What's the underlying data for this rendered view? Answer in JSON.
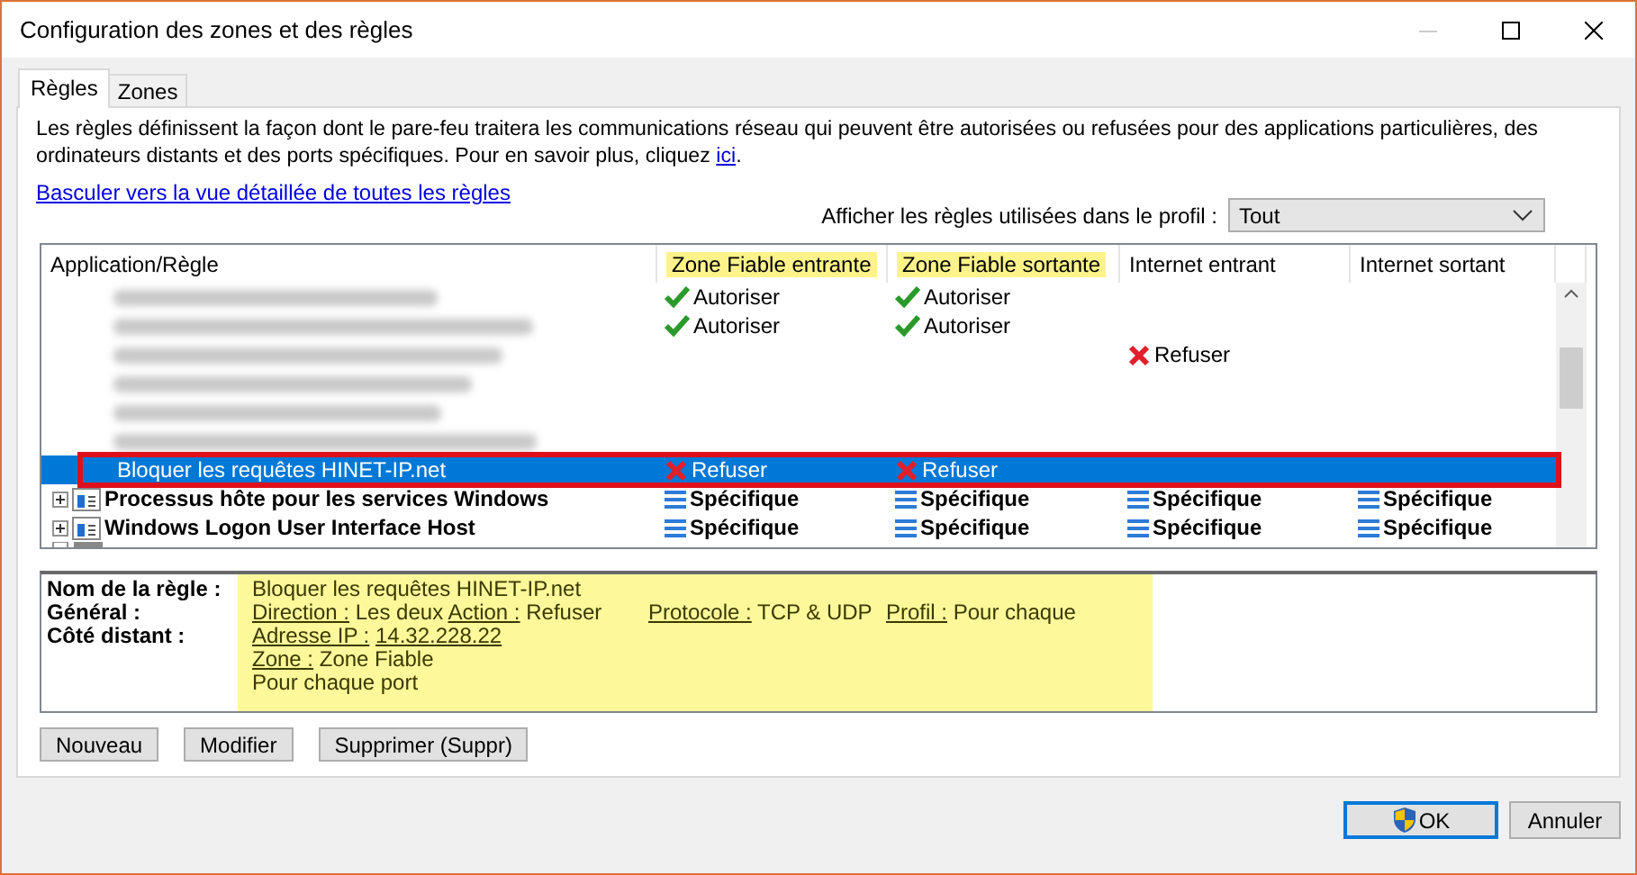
{
  "window": {
    "title": "Configuration des zones et des règles"
  },
  "tabs": [
    {
      "label": "Règles",
      "selected": true
    },
    {
      "label": "Zones",
      "selected": false
    }
  ],
  "description": {
    "text_before": "Les règles définissent la façon dont le pare-feu traitera les communications réseau qui peuvent être autorisées ou refusées pour des applications particulières, des ordinateurs distants et des ports spécifiques. Pour en savoir plus, cliquez ",
    "link": "ici",
    "text_after": "."
  },
  "detail_view_link": "Basculer vers la vue détaillée de toutes les règles",
  "profile_filter": {
    "label": "Afficher les règles utilisées dans le profil :",
    "value": "Tout"
  },
  "rules_table": {
    "columns": [
      {
        "label": "Application/Règle",
        "highlighted": false
      },
      {
        "label": "Zone Fiable entrante",
        "highlighted": true
      },
      {
        "label": "Zone Fiable sortante",
        "highlighted": true
      },
      {
        "label": "Internet entrant",
        "highlighted": false
      },
      {
        "label": "Internet sortant",
        "highlighted": false
      }
    ],
    "rows": [
      {
        "kind": "blurred",
        "selected": false,
        "cells": [
          null,
          {
            "kind": "allow",
            "text": "Autoriser"
          },
          {
            "kind": "allow",
            "text": "Autoriser"
          },
          null,
          null
        ]
      },
      {
        "kind": "blurred",
        "selected": false,
        "cells": [
          null,
          {
            "kind": "allow",
            "text": "Autoriser"
          },
          {
            "kind": "allow",
            "text": "Autoriser"
          },
          null,
          null
        ]
      },
      {
        "kind": "blurred",
        "selected": false,
        "cells": [
          null,
          null,
          null,
          {
            "kind": "deny",
            "text": "Refuser"
          },
          null
        ]
      },
      {
        "kind": "blurred",
        "selected": false,
        "cells": [
          null,
          null,
          null,
          null,
          null
        ]
      },
      {
        "kind": "blurred",
        "selected": false,
        "cells": [
          null,
          null,
          null,
          null,
          null
        ]
      },
      {
        "kind": "blurred",
        "selected": false,
        "cells": [
          null,
          null,
          null,
          null,
          null
        ]
      },
      {
        "kind": "rule",
        "selected": true,
        "outlined": true,
        "cells": [
          {
            "text": "Bloquer les requêtes HINET-IP.net"
          },
          {
            "kind": "deny",
            "text": "Refuser"
          },
          {
            "kind": "deny",
            "text": "Refuser"
          },
          null,
          null
        ]
      },
      {
        "kind": "app",
        "selected": false,
        "expanded": false,
        "cells": [
          {
            "text": "Processus hôte pour les services Windows"
          },
          {
            "kind": "specific",
            "text": "Spécifique"
          },
          {
            "kind": "specific",
            "text": "Spécifique"
          },
          {
            "kind": "specific",
            "text": "Spécifique"
          },
          {
            "kind": "specific",
            "text": "Spécifique"
          }
        ]
      },
      {
        "kind": "app",
        "selected": false,
        "expanded": false,
        "cells": [
          {
            "text": "Windows Logon User Interface Host"
          },
          {
            "kind": "specific",
            "text": "Spécifique"
          },
          {
            "kind": "specific",
            "text": "Spécifique"
          },
          {
            "kind": "specific",
            "text": "Spécifique"
          },
          {
            "kind": "specific",
            "text": "Spécifique"
          }
        ]
      },
      {
        "kind": "cut",
        "selected": false,
        "cells": [
          null,
          null,
          null,
          null,
          null
        ]
      }
    ]
  },
  "details": {
    "highlighted": true,
    "labels": [
      "Nom de la règle :",
      "Général :",
      "Côté distant :"
    ],
    "rule_name": "Bloquer les requêtes HINET-IP.net",
    "general": [
      [
        {
          "key": "Direction :",
          "value": "Les deux"
        },
        {
          "key": "Action :",
          "value": "Refuser"
        }
      ],
      [
        {
          "key": "Protocole :",
          "value": "TCP & UDP"
        }
      ],
      [
        {
          "key": "Profil :",
          "value": "Pour chaque"
        }
      ]
    ],
    "address": {
      "key": "Adresse IP :",
      "value": "14.32.228.22",
      "value_underlined": true
    },
    "zone": {
      "key": "Zone :",
      "value": "Zone Fiable",
      "value_underlined": false
    },
    "port": "Pour chaque port"
  },
  "rule_buttons": [
    "Nouveau",
    "Modifier",
    "Supprimer (Suppr)"
  ],
  "dialog_buttons": [
    {
      "label": "OK",
      "kind": "default",
      "elevated": true
    },
    {
      "label": "Annuler",
      "kind": "normal",
      "elevated": false
    }
  ]
}
